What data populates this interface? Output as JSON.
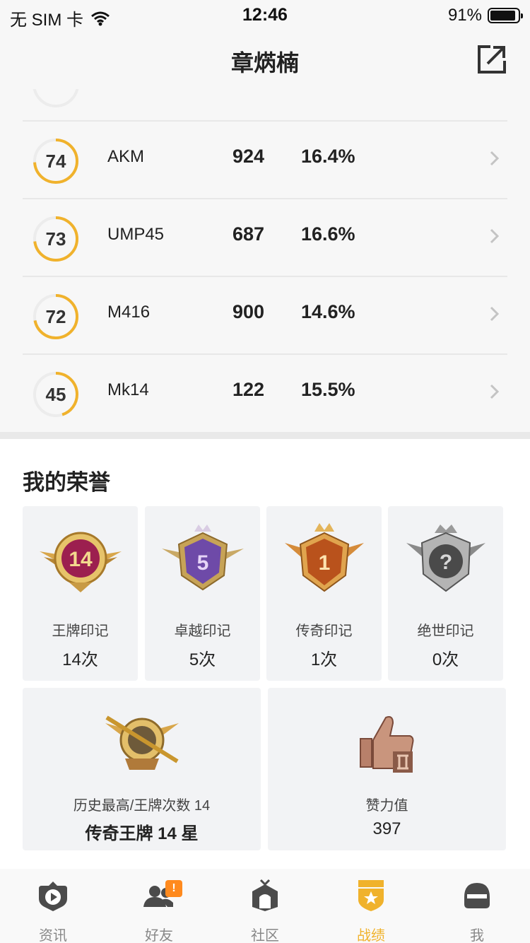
{
  "status_bar": {
    "carrier": "无 SIM 卡",
    "time": "12:46",
    "battery": "91%",
    "battery_level": 0.91
  },
  "header": {
    "title": "章焫楠"
  },
  "weapons": [
    {
      "score": "74",
      "score_fill": 0.74,
      "name": "AKM",
      "kills": "924",
      "rate": "16.4%"
    },
    {
      "score": "73",
      "score_fill": 0.73,
      "name": "UMP45",
      "kills": "687",
      "rate": "16.6%"
    },
    {
      "score": "72",
      "score_fill": 0.72,
      "name": "M416",
      "kills": "900",
      "rate": "14.6%"
    },
    {
      "score": "45",
      "score_fill": 0.45,
      "name": "Mk14",
      "kills": "122",
      "rate": "15.5%"
    }
  ],
  "honors": {
    "title": "我的荣誉",
    "badges": [
      {
        "label": "王牌印记",
        "count": "14次",
        "badge_number": "14",
        "icon": "ace-mark-badge"
      },
      {
        "label": "卓越印记",
        "count": "5次",
        "badge_number": "5",
        "icon": "excellence-mark-badge"
      },
      {
        "label": "传奇印记",
        "count": "1次",
        "badge_number": "1",
        "icon": "legend-mark-badge"
      },
      {
        "label": "绝世印记",
        "count": "0次",
        "badge_number": "?",
        "icon": "peerless-mark-badge"
      }
    ],
    "highest": {
      "label": "历史最高/王牌次数 14",
      "value": "传奇王牌 14 星",
      "icon": "rifle-crest-badge"
    },
    "likes": {
      "label": "赞力值",
      "value": "397",
      "icon": "thumbs-up-badge"
    }
  },
  "tabs": [
    {
      "label": "资讯",
      "icon": "news-play-icon",
      "active": false
    },
    {
      "label": "好友",
      "icon": "friends-icon",
      "active": false,
      "badge": "!"
    },
    {
      "label": "社区",
      "icon": "community-icon",
      "active": false
    },
    {
      "label": "战绩",
      "icon": "record-shield-icon",
      "active": true
    },
    {
      "label": "我",
      "icon": "helmet-icon",
      "active": false
    }
  ],
  "colors": {
    "accent": "#f0b22c",
    "ring_track": "#ececec",
    "card_bg": "#f2f3f5",
    "badge_orange": "#ff8a1e"
  }
}
